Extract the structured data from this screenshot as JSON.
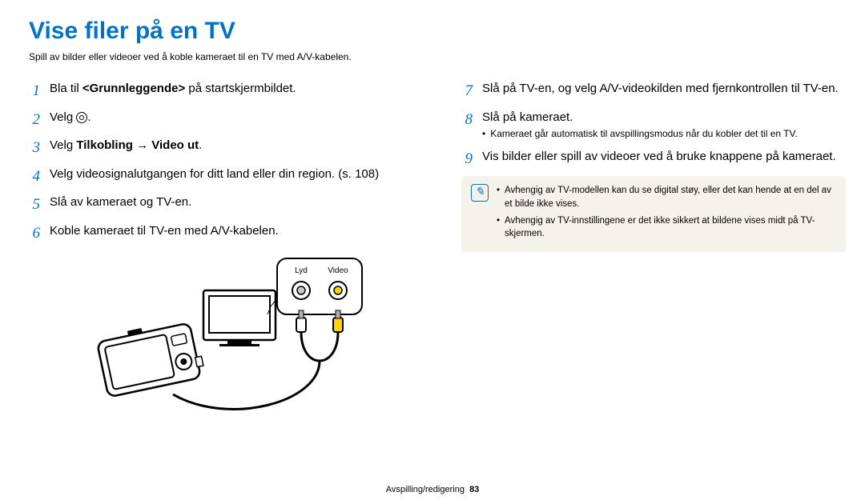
{
  "title": "Vise filer på en TV",
  "subtitle": "Spill av bilder eller videoer ved å koble kameraet til en TV med A/V-kabelen.",
  "steps_left": [
    {
      "n": "1",
      "pre": "Bla til ",
      "bold": "<Grunnleggende>",
      "post": " på startskjermbildet."
    },
    {
      "n": "2",
      "pre": "Velg ",
      "icon": true,
      "post": "."
    },
    {
      "n": "3",
      "pre": "Velg ",
      "bold": "Tilkobling → Video ut",
      "post": "."
    },
    {
      "n": "4",
      "text": "Velg videosignalutgangen for ditt land eller din region. (s. 108)"
    },
    {
      "n": "5",
      "text": "Slå av kameraet og TV-en."
    },
    {
      "n": "6",
      "text": "Koble kameraet til TV-en med A/V-kabelen."
    }
  ],
  "diagram": {
    "label_audio": "Lyd",
    "label_video": "Video"
  },
  "steps_right": [
    {
      "n": "7",
      "text": "Slå på TV-en, og velg A/V-videokilden med fjernkontrollen til TV-en."
    },
    {
      "n": "8",
      "text": "Slå på kameraet.",
      "sub": "Kameraet går automatisk til avspillingsmodus når du kobler det til en TV."
    },
    {
      "n": "9",
      "text": "Vis bilder eller spill av videoer ved å bruke knappene på kameraet."
    }
  ],
  "notes": [
    "Avhengig av TV-modellen kan du se digital støy, eller det kan hende at en del av et bilde ikke vises.",
    "Avhengig av TV-innstillingene er det ikke sikkert at bildene vises midt på TV-skjermen."
  ],
  "footer_section": "Avspilling/redigering",
  "footer_page": "83"
}
